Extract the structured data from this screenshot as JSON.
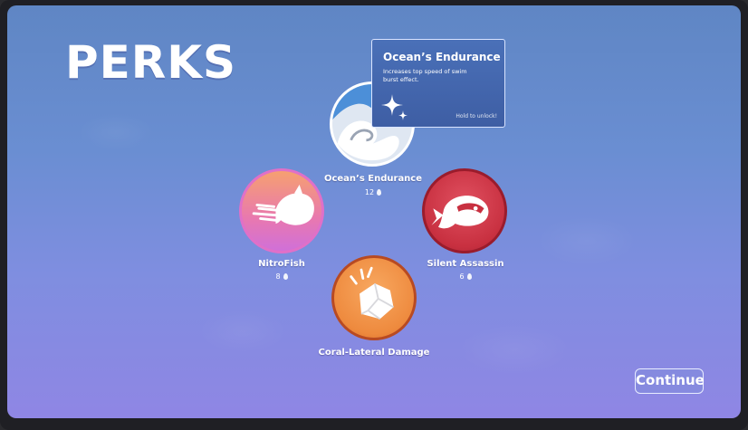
{
  "screen": {
    "title": "PERKS"
  },
  "perks": [
    {
      "name": "Ocean’s Endurance",
      "cost": "12",
      "icon": "wave-icon",
      "color": "#6aa6e6"
    },
    {
      "name": "NitroFish",
      "cost": "8",
      "icon": "speed-fish-icon",
      "color": "#e070c8"
    },
    {
      "name": "Silent Assassin",
      "cost": "6",
      "icon": "ninja-fish-icon",
      "color": "#c83040"
    },
    {
      "name": "Coral-Lateral Damage",
      "cost": "",
      "icon": "rock-icon",
      "color": "#e8803a"
    }
  ],
  "tooltip": {
    "title": "Ocean’s Endurance",
    "description": "Increases top speed of swim burst effect.",
    "hint": "Hold to unlock!",
    "icon": "sparkle-icon"
  },
  "buttons": {
    "continue": "Continue"
  },
  "currency_icon": "droplet-icon"
}
